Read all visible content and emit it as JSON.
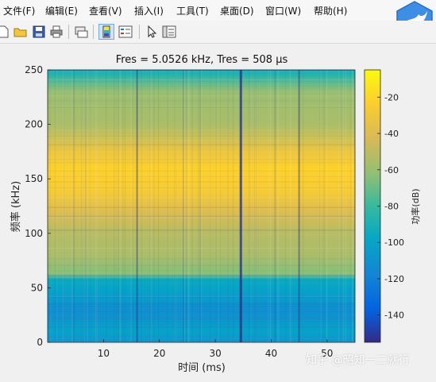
{
  "menu": [
    "文件(F)",
    "编辑(E)",
    "查看(V)",
    "插入(I)",
    "工具(T)",
    "桌面(D)",
    "窗口(W)",
    "帮助(H)"
  ],
  "toolbar": {
    "icons": [
      "new-file-icon",
      "open-folder-icon",
      "save-icon",
      "print-icon",
      "link-figure-icon",
      "insert-colorbar-icon",
      "insert-legend-icon",
      "pointer-icon",
      "property-editor-icon"
    ]
  },
  "chart_data": {
    "type": "heatmap",
    "title": "Fres = 5.0526 kHz, Tres = 508 μs",
    "xlabel": "时间 (ms)",
    "ylabel": "频率 (kHz)",
    "xlim": [
      0,
      55
    ],
    "ylim": [
      0,
      250
    ],
    "xticks": [
      10,
      20,
      30,
      40,
      50
    ],
    "yticks": [
      0,
      50,
      100,
      150,
      200,
      250
    ],
    "colorbar": {
      "label": "功率(dB)",
      "ticks": [
        -20,
        -40,
        -60,
        -80,
        -100,
        -120,
        -140
      ],
      "range": [
        -155,
        -5
      ],
      "colormap": "parula"
    },
    "power_profile_db": [
      {
        "freq_khz": 0,
        "db": -110
      },
      {
        "freq_khz": 10,
        "db": -100
      },
      {
        "freq_khz": 20,
        "db": -108
      },
      {
        "freq_khz": 30,
        "db": -112
      },
      {
        "freq_khz": 40,
        "db": -105
      },
      {
        "freq_khz": 50,
        "db": -100
      },
      {
        "freq_khz": 58,
        "db": -95
      },
      {
        "freq_khz": 62,
        "db": -65
      },
      {
        "freq_khz": 80,
        "db": -55
      },
      {
        "freq_khz": 100,
        "db": -52
      },
      {
        "freq_khz": 120,
        "db": -40
      },
      {
        "freq_khz": 140,
        "db": -25
      },
      {
        "freq_khz": 160,
        "db": -22
      },
      {
        "freq_khz": 175,
        "db": -32
      },
      {
        "freq_khz": 200,
        "db": -55
      },
      {
        "freq_khz": 230,
        "db": -60
      },
      {
        "freq_khz": 245,
        "db": -85
      },
      {
        "freq_khz": 250,
        "db": -95
      }
    ],
    "dark_time_lines_ms": [
      16,
      34.5,
      45
    ],
    "grid": false
  },
  "watermark": "知乎 @昭知一二就行",
  "colors": {
    "window_bg": "#f0f0f0",
    "axes_bg": "#ffffff",
    "logo": "#3f8ee5"
  }
}
